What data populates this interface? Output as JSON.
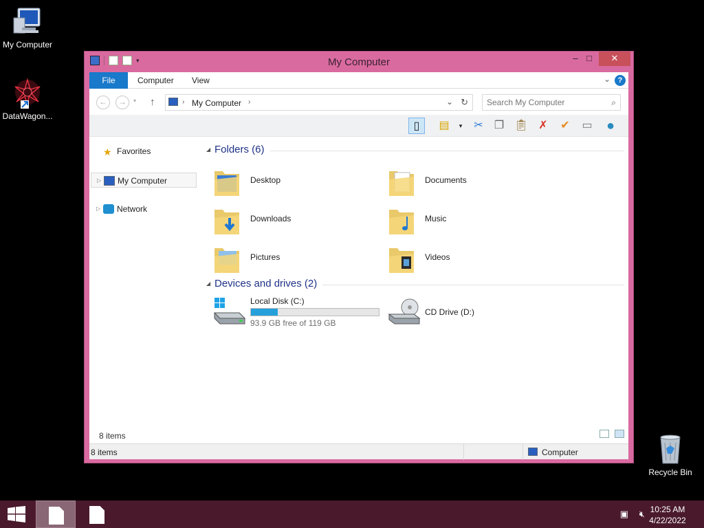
{
  "desktop": {
    "icons": [
      {
        "label": "My Computer"
      },
      {
        "label": "DataWagon..."
      },
      {
        "label": "Recycle Bin"
      }
    ]
  },
  "window": {
    "title": "My Computer",
    "controls": {
      "minimize": "–",
      "maximize": "□",
      "close": "✕"
    }
  },
  "ribbon": {
    "tabs": [
      {
        "label": "File"
      },
      {
        "label": "Computer"
      },
      {
        "label": "View"
      }
    ],
    "help": "?"
  },
  "navbar": {
    "address": "My Computer",
    "search_placeholder": "Search My Computer"
  },
  "navpane": {
    "items": [
      {
        "label": "Favorites"
      },
      {
        "label": "My Computer"
      },
      {
        "label": "Network"
      }
    ]
  },
  "content": {
    "folders_header": "Folders (6)",
    "folders": [
      {
        "label": "Desktop"
      },
      {
        "label": "Documents"
      },
      {
        "label": "Downloads"
      },
      {
        "label": "Music"
      },
      {
        "label": "Pictures"
      },
      {
        "label": "Videos"
      }
    ],
    "drives_header": "Devices and drives (2)",
    "drives": [
      {
        "label": "Local Disk (C:)",
        "free_text": "93.9 GB free of 119 GB",
        "used_fraction": 0.21
      },
      {
        "label": "CD Drive (D:)"
      }
    ]
  },
  "items_count": "8 items",
  "statusbar": {
    "left": "8 items",
    "right": "Computer"
  },
  "taskbar": {
    "time": "10:25 AM",
    "date": "4/22/2022"
  },
  "colors": {
    "window_border": "#d96a9f",
    "accent": "#1979ca",
    "taskbar": "#4a1a2c"
  }
}
